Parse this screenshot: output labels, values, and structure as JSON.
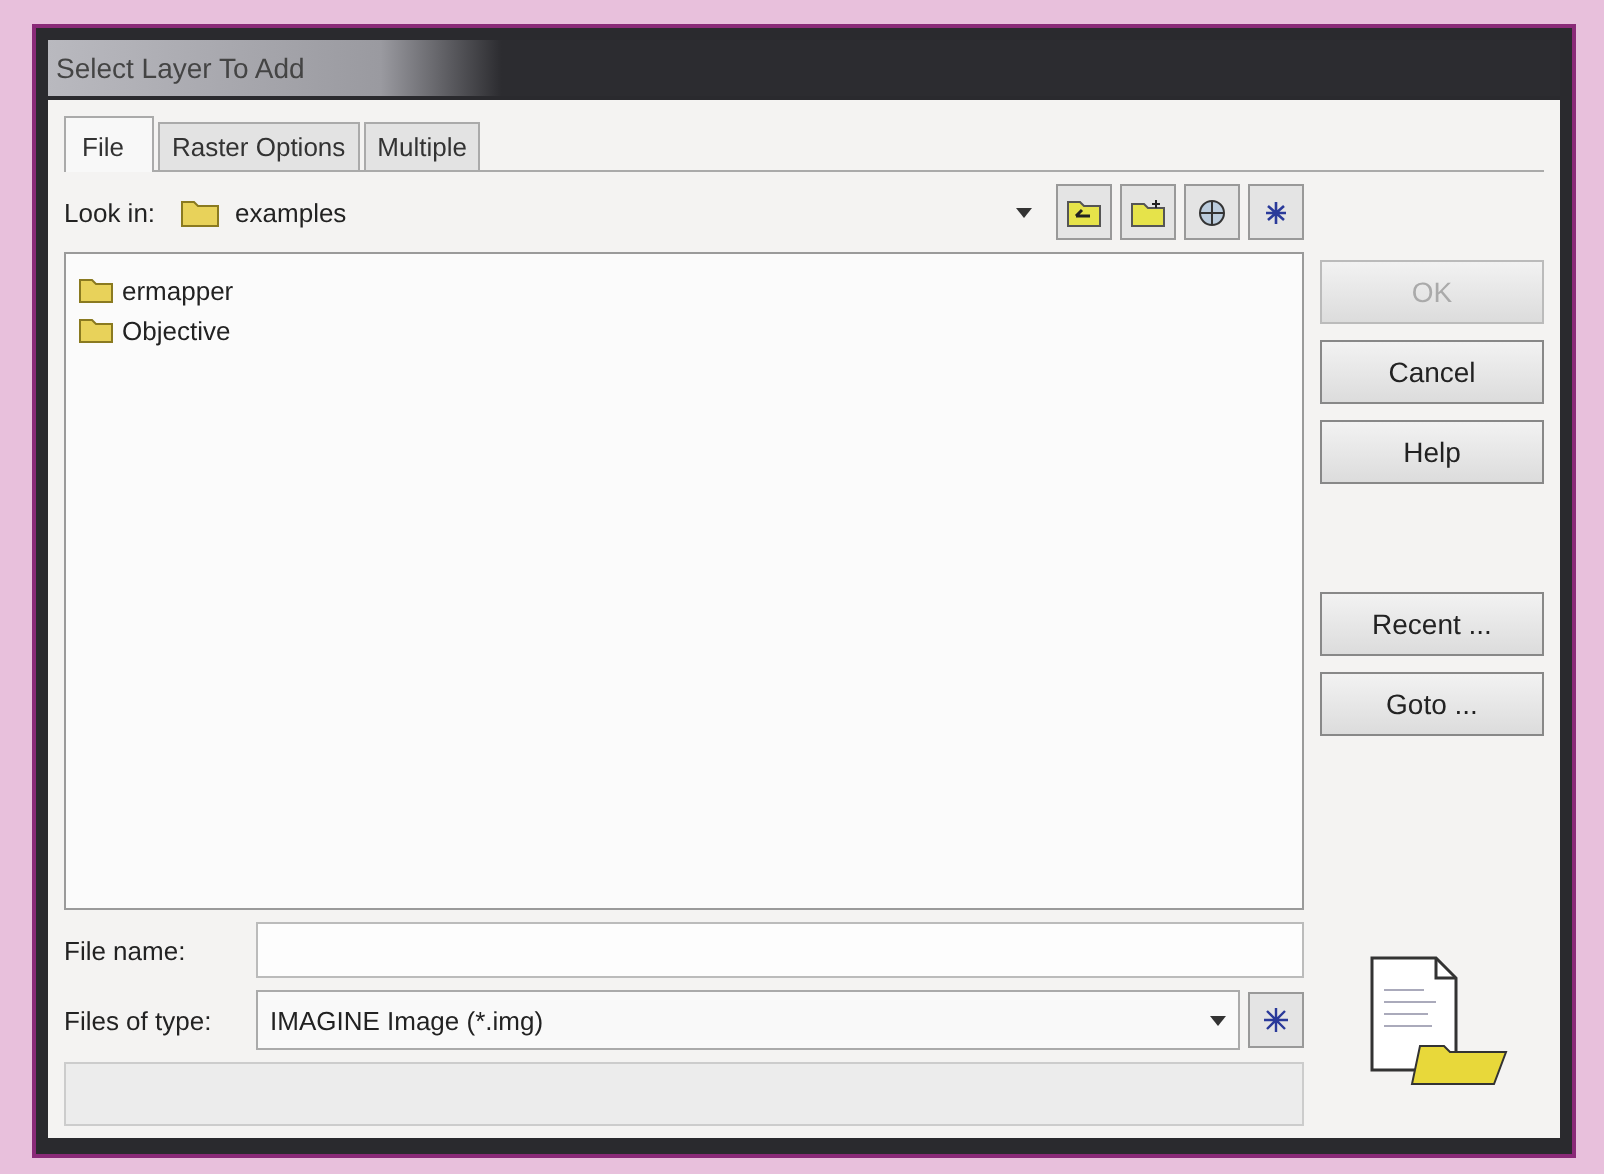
{
  "window": {
    "title": "Select Layer To Add"
  },
  "tabs": [
    {
      "label": "File",
      "selected": true
    },
    {
      "label": "Raster Options",
      "selected": false
    },
    {
      "label": "Multiple",
      "selected": false
    }
  ],
  "look_in": {
    "label": "Look in:",
    "value": "examples"
  },
  "files": [
    {
      "name": "ermapper"
    },
    {
      "name": "Objective"
    }
  ],
  "buttons": [
    {
      "label": "OK",
      "disabled": true
    },
    {
      "label": "Cancel",
      "disabled": false
    },
    {
      "label": "Help",
      "disabled": false
    },
    {
      "label": "Recent ...",
      "disabled": false
    },
    {
      "label": "Goto ...",
      "disabled": false
    }
  ],
  "file_name": {
    "label": "File name:"
  },
  "file_type": {
    "label": "Files of type:",
    "value": "IMAGINE Image (*.img)"
  }
}
